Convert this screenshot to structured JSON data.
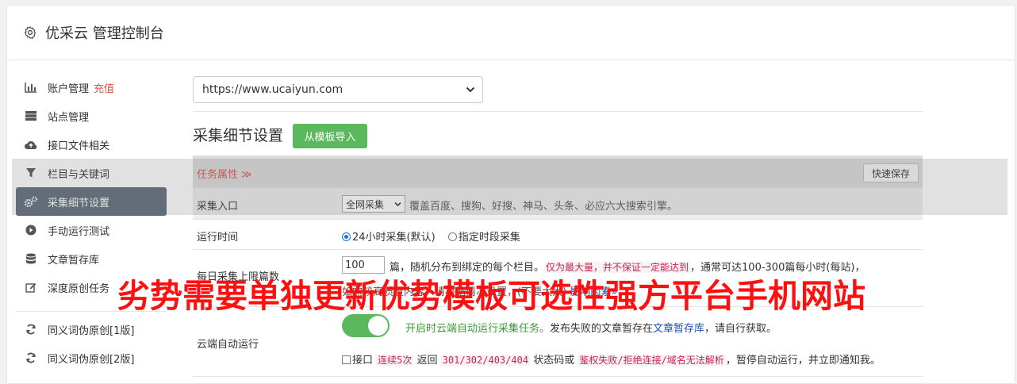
{
  "app": {
    "title": "优采云 管理控制台",
    "icon": "gear-icon"
  },
  "sidebar": {
    "items": [
      {
        "label": "账户管理",
        "accent": "充值",
        "icon": "bar-chart-icon"
      },
      {
        "label": "站点管理",
        "icon": "server-icon"
      },
      {
        "label": "接口文件相关",
        "icon": "cloud-upload-icon"
      },
      {
        "label": "栏目与关键词",
        "icon": "filter-icon"
      },
      {
        "label": "采集细节设置",
        "icon": "gears-icon",
        "active": true
      },
      {
        "label": "手动运行测试",
        "icon": "play-circle-icon"
      },
      {
        "label": "文章暂存库",
        "icon": "database-icon"
      },
      {
        "label": "深度原创任务",
        "icon": "edit-icon"
      }
    ],
    "items2": [
      {
        "label": "同义词伪原创[1版]",
        "icon": "refresh-icon"
      },
      {
        "label": "同义词伪原创[2版]",
        "icon": "refresh-icon"
      }
    ]
  },
  "site_select": {
    "value": "https://www.ucaiyun.com"
  },
  "section": {
    "title": "采集细节设置",
    "import_button": "从模板导入"
  },
  "table": {
    "head": {
      "task_attr": "任务属性 ≫",
      "quick_save": "快速保存"
    },
    "entry": {
      "label": "采集入口",
      "select": "全网采集",
      "desc": "覆盖百度、搜狗、好搜、神马、头条、必应六大搜索引擎。"
    },
    "run_time": {
      "label": "运行时间",
      "opt1": "24小时采集(默认)",
      "opt2": "指定时段采集"
    },
    "daily": {
      "label": "每日采集上限篇数",
      "value": "100",
      "t1": "篇，随机分布到绑定的每个栏目。",
      "hl1": "仅为最大量，并不保证一定能达到",
      "t2": "，通常可达100-300篇每小时(每站)，",
      "line2": "如需较高质量内容，请根据情况设置，",
      "line2b": "(不要太大)",
      "link": "影响因素»"
    },
    "cloud": {
      "label": "云端自动运行",
      "t1": "开启时云端自动运行采集任务。",
      "t2": "发布失败的文章暂存在",
      "link": "文章暂存库",
      "t3": "，请自行获取。",
      "cb_label": "接口",
      "hl1": "连续5次",
      "t4": "返回",
      "hl2": "301/302/403/404",
      "t5": "状态码或",
      "hl3": "鉴权失败/拒绝连接/域名无法解析",
      "t6": "，暂停自动运行，并立即通知我。"
    }
  },
  "watermark": "劣势需要单独更新优势模板可选性强方平台手机网站",
  "colors": {
    "accent_red": "#d9534f",
    "green": "#5cb85c",
    "active_nav": "#5e6b7a",
    "watermark": "#ff1010"
  }
}
